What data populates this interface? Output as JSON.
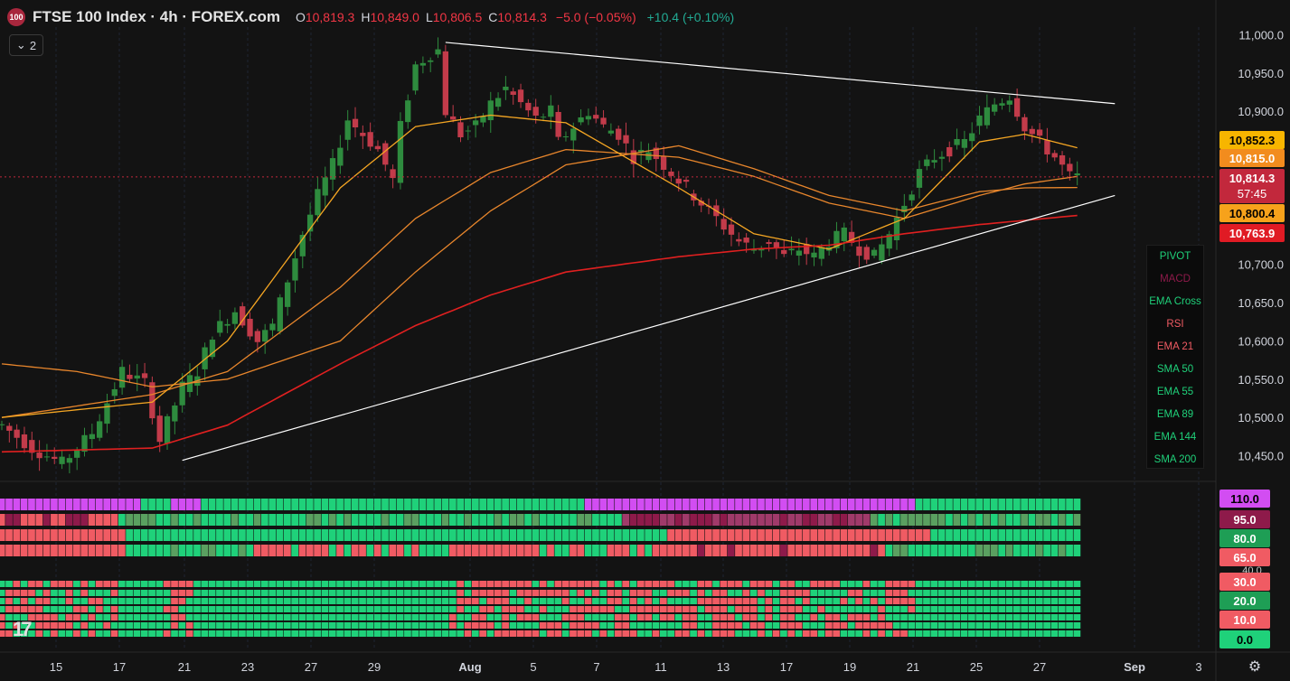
{
  "header": {
    "badge": "100",
    "title": "FTSE 100 Index · 4h · FOREX.com",
    "open_label": "O",
    "open": "10,819.3",
    "high_label": "H",
    "high": "10,849.0",
    "low_label": "L",
    "low": "10,806.5",
    "close_label": "C",
    "close": "10,814.3",
    "change": "−5.0 (−0.05%)",
    "change2": "+10.4 (+0.10%)",
    "collapse_count": "2"
  },
  "colors": {
    "background": "#131313",
    "up": "#2e8b3e",
    "down": "#c23b4a",
    "ema_short": "#f5a623",
    "ema_mid": "#e8862c",
    "sma_200": "#e02020",
    "trendline": "#ffffff",
    "heat_green": "#1fd17a",
    "heat_red": "#f05b63",
    "heat_magenta": "#d24df2",
    "heat_darkred": "#8e1a4a",
    "heat_olive": "#5aa060"
  },
  "price_axis": {
    "ticks": [
      "11,000.0",
      "10,950.0",
      "10,900.0",
      "10,700.0",
      "10,650.0",
      "10,600.0",
      "10,550.0",
      "10,500.0",
      "10,450.0"
    ],
    "tick_values": [
      11000,
      10950,
      10900,
      10700,
      10650,
      10600,
      10550,
      10500,
      10450
    ],
    "badges": [
      {
        "label": "10,852.3",
        "value": 10852.3,
        "bg": "#f7b500",
        "fg": "#000000"
      },
      {
        "label": "10,815.0",
        "value": 10815.0,
        "bg": "#f28c1e",
        "fg": "#ffffff"
      },
      {
        "label": "10,814.3",
        "value": 10814.3,
        "bg": "#c2283c",
        "fg": "#ffffff",
        "sub": "57:45"
      },
      {
        "label": "10,800.4",
        "value": 10800.4,
        "bg": "#f7a21b",
        "fg": "#000000"
      },
      {
        "label": "10,763.9",
        "value": 10763.9,
        "bg": "#e01b24",
        "fg": "#ffffff"
      }
    ]
  },
  "lower_axis": {
    "badges": [
      {
        "label": "110.0",
        "bg": "#d24df2",
        "fg": "#000000"
      },
      {
        "label": "95.0",
        "bg": "#8e1a4a",
        "fg": "#ffffff"
      },
      {
        "label": "80.0",
        "bg": "#1e9e55",
        "fg": "#ffffff"
      },
      {
        "label": "65.0",
        "bg": "#f05b63",
        "fg": "#ffffff"
      },
      {
        "label": "40.0",
        "bg": "#131313",
        "fg": "#cccccc"
      },
      {
        "label": "30.0",
        "bg": "#f05b63",
        "fg": "#ffffff"
      },
      {
        "label": "20.0",
        "bg": "#1e9e55",
        "fg": "#ffffff"
      },
      {
        "label": "10.0",
        "bg": "#f05b63",
        "fg": "#ffffff"
      },
      {
        "label": "0.0",
        "bg": "#1fd17a",
        "fg": "#000000"
      }
    ]
  },
  "time_axis": {
    "labels": [
      "15",
      "17",
      "21",
      "23",
      "27",
      "29",
      "Aug",
      "5",
      "7",
      "11",
      "13",
      "17",
      "19",
      "21",
      "25",
      "27",
      "Sep",
      "3"
    ]
  },
  "legend": [
    {
      "label": "PIVOT",
      "color": "#1fd17a"
    },
    {
      "label": "MACD",
      "color": "#8e1a4a"
    },
    {
      "label": "EMA Cross",
      "color": "#1fd17a"
    },
    {
      "label": "RSI",
      "color": "#f05b63"
    },
    {
      "label": "EMA 21",
      "color": "#f05b63"
    },
    {
      "label": "SMA 50",
      "color": "#1fd17a"
    },
    {
      "label": "EMA 55",
      "color": "#1fd17a"
    },
    {
      "label": "EMA 89",
      "color": "#1fd17a"
    },
    {
      "label": "EMA 144",
      "color": "#1fd17a"
    },
    {
      "label": "SMA 200",
      "color": "#1fd17a"
    }
  ],
  "logo": "17",
  "settings_icon": "gear-icon",
  "chart_data": {
    "type": "candlestick",
    "instrument": "FTSE 100 Index",
    "timeframe": "4h",
    "ylim": [
      10420,
      11010
    ],
    "x_labels": [
      "15",
      "17",
      "21",
      "23",
      "27",
      "29",
      "Aug",
      "5",
      "7",
      "11",
      "13",
      "17",
      "19",
      "21",
      "25",
      "27",
      "Sep",
      "3"
    ],
    "close_path": [
      [
        0,
        10490
      ],
      [
        4,
        10460
      ],
      [
        8,
        10440
      ],
      [
        12,
        10480
      ],
      [
        16,
        10560
      ],
      [
        19,
        10545
      ],
      [
        21,
        10470
      ],
      [
        24,
        10540
      ],
      [
        26,
        10560
      ],
      [
        28,
        10610
      ],
      [
        31,
        10640
      ],
      [
        34,
        10600
      ],
      [
        36,
        10620
      ],
      [
        38,
        10680
      ],
      [
        40,
        10740
      ],
      [
        42,
        10790
      ],
      [
        44,
        10830
      ],
      [
        46,
        10890
      ],
      [
        48,
        10870
      ],
      [
        50,
        10850
      ],
      [
        52,
        10810
      ],
      [
        53,
        10880
      ],
      [
        55,
        10960
      ],
      [
        57,
        10975
      ],
      [
        58,
        10980
      ],
      [
        59,
        10900
      ],
      [
        61,
        10870
      ],
      [
        63,
        10880
      ],
      [
        65,
        10910
      ],
      [
        67,
        10930
      ],
      [
        69,
        10910
      ],
      [
        71,
        10890
      ],
      [
        73,
        10900
      ],
      [
        74,
        10860
      ],
      [
        76,
        10880
      ],
      [
        78,
        10900
      ],
      [
        80,
        10880
      ],
      [
        82,
        10870
      ],
      [
        84,
        10840
      ],
      [
        86,
        10850
      ],
      [
        88,
        10830
      ],
      [
        90,
        10810
      ],
      [
        92,
        10790
      ],
      [
        94,
        10770
      ],
      [
        96,
        10750
      ],
      [
        98,
        10730
      ],
      [
        100,
        10720
      ],
      [
        102,
        10730
      ],
      [
        104,
        10710
      ],
      [
        106,
        10720
      ],
      [
        108,
        10710
      ],
      [
        110,
        10730
      ],
      [
        112,
        10740
      ],
      [
        114,
        10720
      ],
      [
        116,
        10710
      ],
      [
        118,
        10740
      ],
      [
        120,
        10780
      ],
      [
        122,
        10820
      ],
      [
        124,
        10840
      ],
      [
        126,
        10850
      ],
      [
        128,
        10860
      ],
      [
        130,
        10890
      ],
      [
        132,
        10910
      ],
      [
        134,
        10920
      ],
      [
        136,
        10880
      ],
      [
        138,
        10860
      ],
      [
        140,
        10840
      ],
      [
        142,
        10815
      ],
      [
        143,
        10814.3
      ]
    ],
    "ema_short_path": [
      [
        0,
        10500
      ],
      [
        20,
        10520
      ],
      [
        30,
        10600
      ],
      [
        45,
        10800
      ],
      [
        55,
        10880
      ],
      [
        65,
        10895
      ],
      [
        75,
        10885
      ],
      [
        90,
        10800
      ],
      [
        100,
        10740
      ],
      [
        110,
        10720
      ],
      [
        120,
        10760
      ],
      [
        130,
        10860
      ],
      [
        136,
        10870
      ],
      [
        143,
        10852.3
      ]
    ],
    "ema_mid_path": [
      [
        0,
        10500
      ],
      [
        20,
        10530
      ],
      [
        30,
        10560
      ],
      [
        45,
        10670
      ],
      [
        55,
        10760
      ],
      [
        65,
        10820
      ],
      [
        75,
        10850
      ],
      [
        90,
        10840
      ],
      [
        100,
        10815
      ],
      [
        110,
        10780
      ],
      [
        120,
        10760
      ],
      [
        130,
        10790
      ],
      [
        136,
        10805
      ],
      [
        143,
        10815.0
      ]
    ],
    "ema_slow_path": [
      [
        0,
        10570
      ],
      [
        10,
        10560
      ],
      [
        20,
        10540
      ],
      [
        30,
        10550
      ],
      [
        45,
        10600
      ],
      [
        55,
        10690
      ],
      [
        65,
        10770
      ],
      [
        75,
        10830
      ],
      [
        90,
        10855
      ],
      [
        100,
        10825
      ],
      [
        110,
        10790
      ],
      [
        120,
        10770
      ],
      [
        130,
        10795
      ],
      [
        136,
        10800
      ],
      [
        143,
        10800.4
      ]
    ],
    "sma_200_path": [
      [
        0,
        10455
      ],
      [
        20,
        10460
      ],
      [
        30,
        10490
      ],
      [
        45,
        10570
      ],
      [
        55,
        10620
      ],
      [
        65,
        10660
      ],
      [
        75,
        10690
      ],
      [
        90,
        10710
      ],
      [
        100,
        10720
      ],
      [
        110,
        10725
      ],
      [
        120,
        10740
      ],
      [
        130,
        10752
      ],
      [
        143,
        10763.9
      ]
    ],
    "trendlines": [
      {
        "from": [
          24,
          10444
        ],
        "to": [
          148,
          10790
        ]
      },
      {
        "from": [
          59,
          10990
        ],
        "to": [
          148,
          10910
        ]
      }
    ]
  }
}
